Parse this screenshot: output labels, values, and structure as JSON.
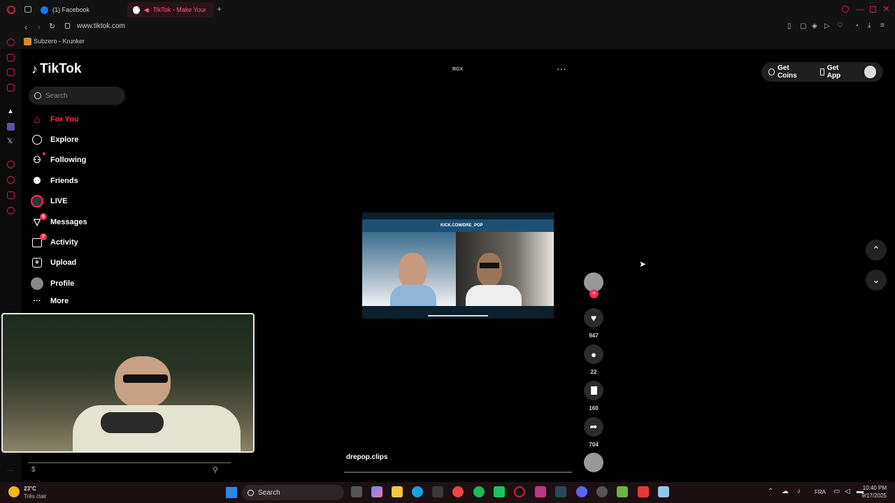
{
  "browser": {
    "tabs": [
      {
        "label": "(1) Facebook",
        "active": false
      },
      {
        "label": "TikTok - Make Your Da",
        "active": true
      }
    ],
    "url": "www.tiktok.com",
    "bookmark": "Subzero - Krunker"
  },
  "tiktok": {
    "logo": "TikTok",
    "search_placeholder": "Search",
    "nav": [
      {
        "label": "For You",
        "icon": "home-icon",
        "active": true
      },
      {
        "label": "Explore",
        "icon": "compass-icon"
      },
      {
        "label": "Following",
        "icon": "following-icon"
      },
      {
        "label": "Friends",
        "icon": "friends-icon"
      },
      {
        "label": "LIVE",
        "icon": "live-icon"
      },
      {
        "label": "Messages",
        "icon": "messages-icon",
        "badge": "5"
      },
      {
        "label": "Activity",
        "icon": "activity-icon",
        "badge": "7"
      },
      {
        "label": "Upload",
        "icon": "upload-icon"
      },
      {
        "label": "Profile",
        "icon": "profile-icon"
      },
      {
        "label": "More",
        "icon": "more-icon"
      }
    ],
    "header_label": "RGX",
    "get_coins": "Get Coins",
    "get_app": "Get App",
    "video": {
      "overlay_text": "KICK.COM/DRE_POP",
      "author": "drepop.clips",
      "likes": "947",
      "comments": "22",
      "bookmarks": "160",
      "shares": "704"
    }
  },
  "taskbar": {
    "weather_temp": "23°C",
    "weather_desc": "Très clair",
    "search": "Search",
    "lang": "FRA",
    "time": "10:40 PM",
    "date": "9/17/2025"
  },
  "colors": {
    "accent": "#fe2c55",
    "opera": "#c8213d"
  }
}
